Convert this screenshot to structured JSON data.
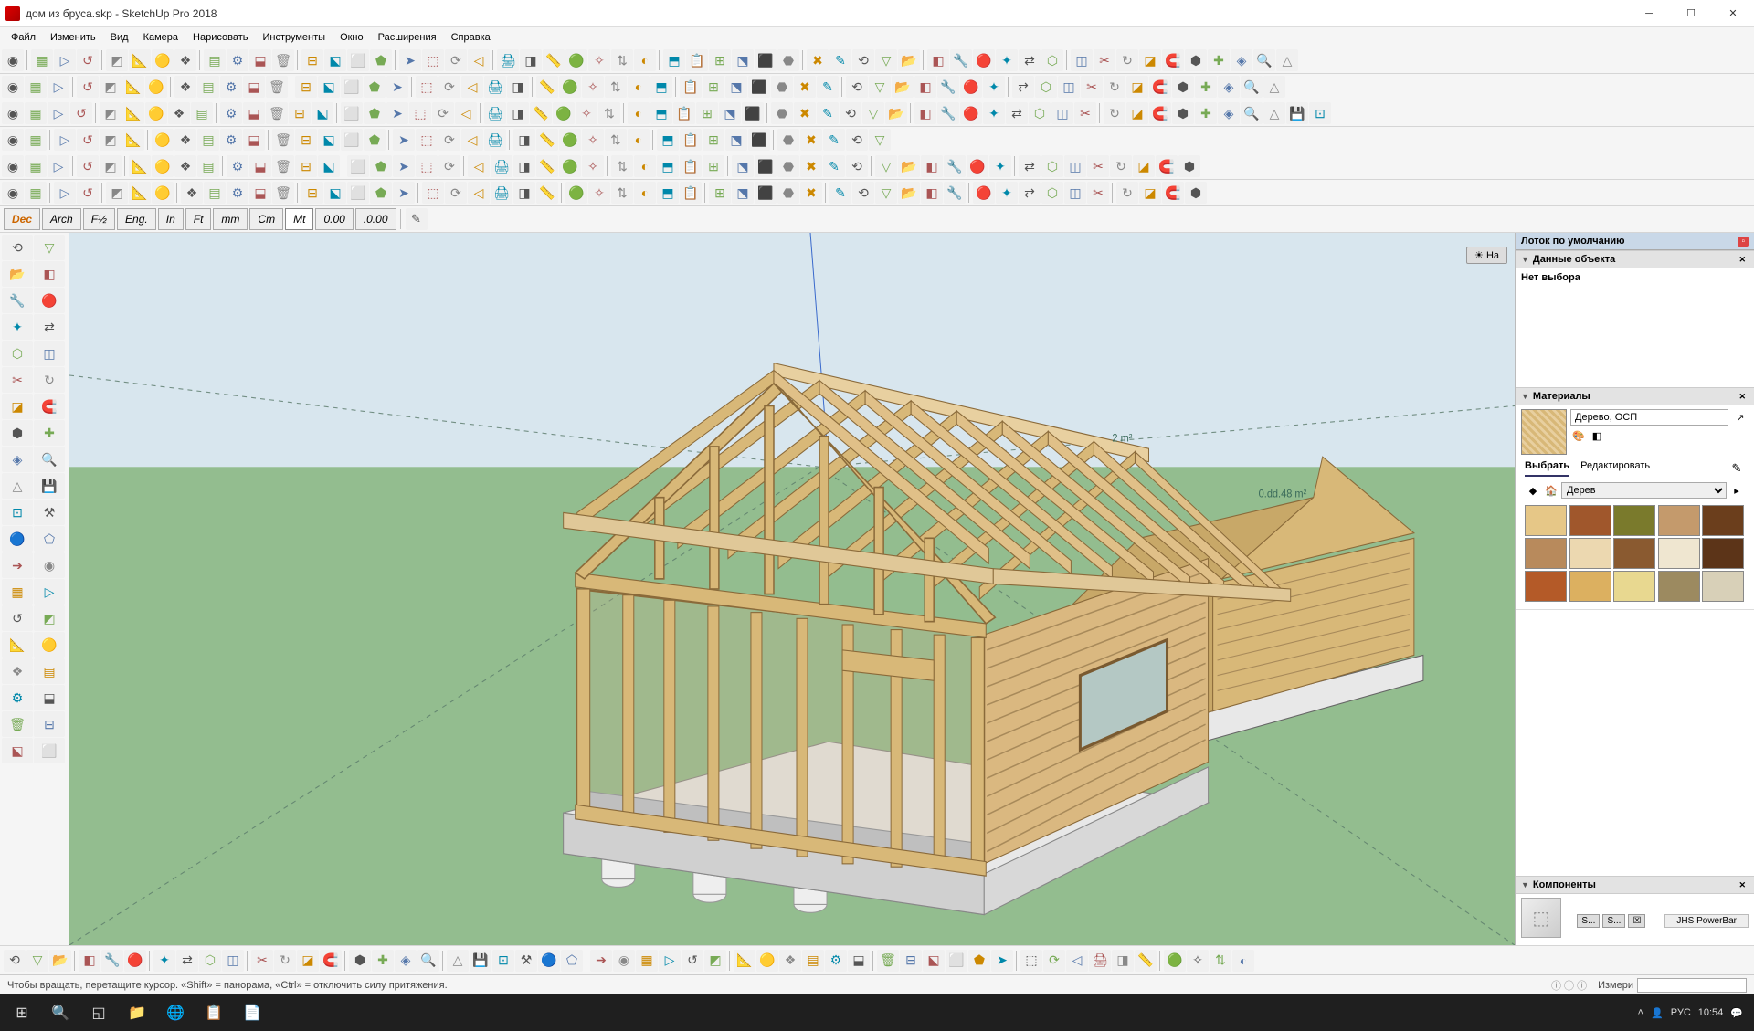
{
  "title": "дом из бруса.skp - SketchUp Pro 2018",
  "menu": [
    "Файл",
    "Изменить",
    "Вид",
    "Камера",
    "Нарисовать",
    "Инструменты",
    "Окно",
    "Расширения",
    "Справка"
  ],
  "units": [
    "Dec",
    "Arch",
    "F½",
    "Eng.",
    "In",
    "Ft",
    "mm",
    "Cm",
    "Mt",
    "0.00",
    ".0.00"
  ],
  "active_unit": "Mt",
  "tray": {
    "title": "Лоток по умолчанию",
    "entity": {
      "header": "Данные объекта",
      "text": "Нет выбора"
    },
    "materials": {
      "header": "Материалы",
      "name": "Дерево, ОСП",
      "tabs": [
        "Выбрать",
        "Редактировать"
      ],
      "dropdown": "Дерев",
      "swatches": [
        "#e6c787",
        "#a0572c",
        "#7a7a2c",
        "#c49a6c",
        "#6b3e1c",
        "#b88a5c",
        "#ecd8b0",
        "#8a5a30",
        "#efe6d0",
        "#5c3418",
        "#b45a28",
        "#dcb060",
        "#e8d890",
        "#9c8a60",
        "#d8d0b8"
      ]
    },
    "components": {
      "header": "Компоненты"
    }
  },
  "viewport": {
    "button_label": "На",
    "label1": "2 m²",
    "label2": "48 m²",
    "label_prefix": "0.dd."
  },
  "status": {
    "hint": "Чтобы вращать, перетащите курсор. «Shift» = панорама, «Ctrl» = отключить силу притяжения.",
    "measure_label": "Измери",
    "powerbar": "JHS PowerBar"
  },
  "taskbar": {
    "lang": "РУС",
    "time": "10:54"
  }
}
